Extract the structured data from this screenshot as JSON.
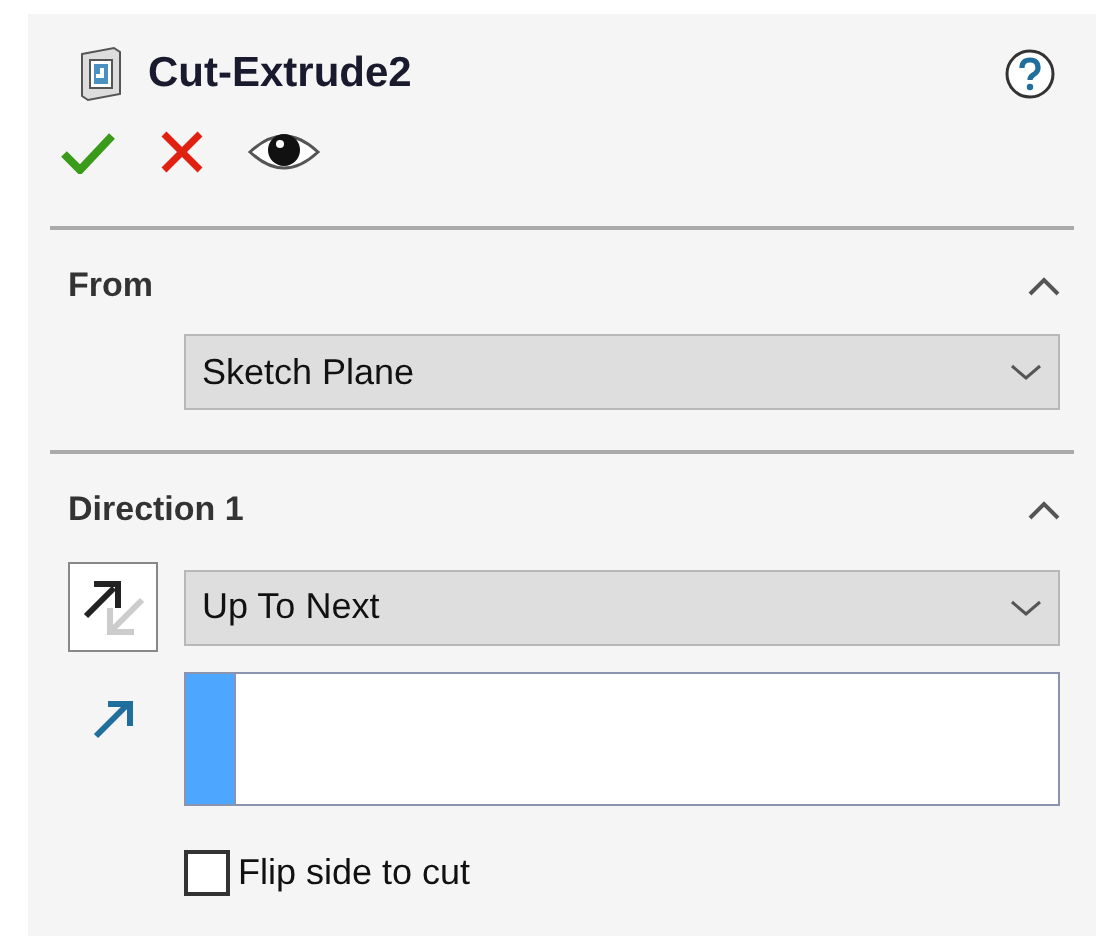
{
  "title": "Cut-Extrude2",
  "sections": [
    {
      "kind": "from",
      "heading": "From",
      "expanded": true,
      "dropdown": "Sketch Plane"
    },
    {
      "kind": "direction",
      "heading": "Direction 1",
      "expanded": true,
      "dropdown": "Up To Next",
      "flip": {
        "label": "Flip side to cut",
        "checked": false
      }
    }
  ]
}
